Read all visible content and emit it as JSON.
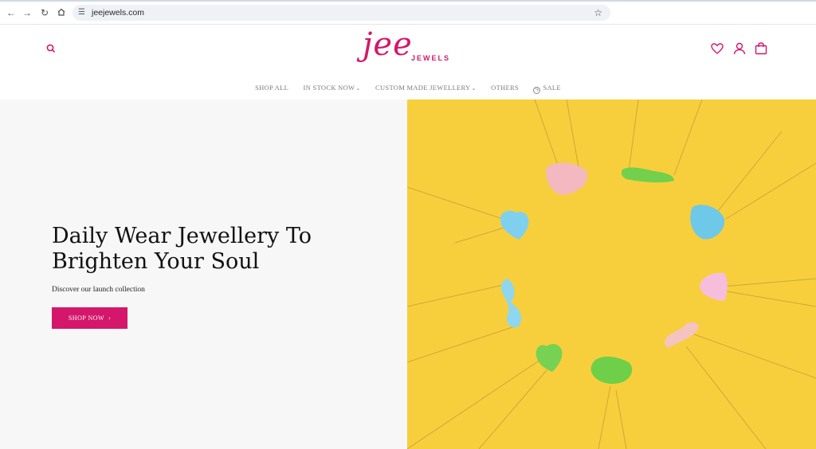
{
  "browser": {
    "url": "jeejewels.com",
    "back_icon": "arrow-left-icon",
    "forward_icon": "arrow-right-icon",
    "reload_icon": "reload-icon",
    "home_icon": "home-icon",
    "site_info_icon": "tune-icon",
    "bookmark_icon": "star-icon"
  },
  "header": {
    "logo_script": "jee",
    "logo_sub": "JEWELS",
    "icons": [
      "search-icon",
      "heart-icon",
      "user-icon",
      "bag-icon"
    ],
    "menu": [
      {
        "label": "SHOP ALL",
        "has_dropdown": false
      },
      {
        "label": "IN STOCK NOW",
        "has_dropdown": true
      },
      {
        "label": "CUSTOM MADE JEWELLERY",
        "has_dropdown": true
      },
      {
        "label": "OTHERS",
        "has_dropdown": false
      },
      {
        "label": "SALE",
        "has_dropdown": false,
        "icon": "sale-icon"
      }
    ]
  },
  "hero": {
    "title_line1": "Daily Wear Jewellery To",
    "title_line2": "Brighten Your Soul",
    "subtitle": "Discover our launch collection",
    "cta": "SHOP NOW",
    "cta_icon": "chevron-right-icon"
  },
  "colors": {
    "brand": "#d4176a",
    "hero_bg": "#f7cf3c",
    "left_bg": "#f7f7f7"
  }
}
